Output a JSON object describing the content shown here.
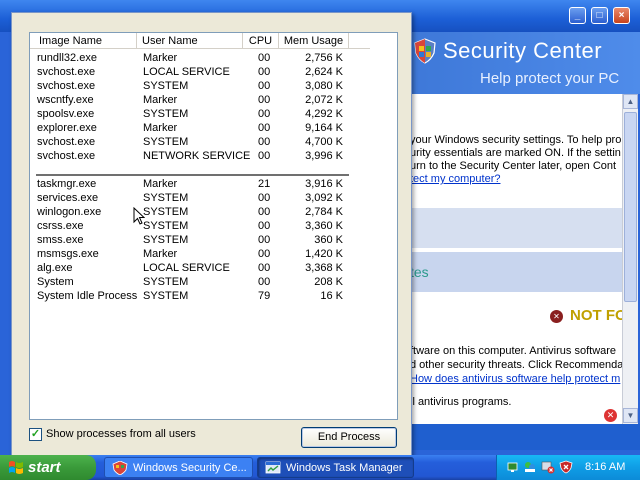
{
  "security_center": {
    "title": "Security Center",
    "subtitle": "Help protect your PC",
    "intro_lines": [
      "your Windows security settings. To help pro",
      "urity essentials are marked ON. If the settin",
      "urn to the Security Center later, open Cont"
    ],
    "intro_link": "tect my computer?",
    "updates_label": "tes",
    "not_found_label": "NOT FO",
    "av_lines": [
      "ftware on this computer. Antivirus software",
      "d other security threats. Click Recommenda"
    ],
    "av_link": "How does antivirus software help protect m",
    "av_line2": "ll antivirus programs."
  },
  "task_manager": {
    "columns": {
      "image": "Image Name",
      "user": "User Name",
      "cpu": "CPU",
      "mem": "Mem Usage"
    },
    "processes": [
      {
        "name": "rundll32.exe",
        "user": "Marker",
        "cpu": "00",
        "mem": "2,756 K"
      },
      {
        "name": "svchost.exe",
        "user": "LOCAL SERVICE",
        "cpu": "00",
        "mem": "2,624 K"
      },
      {
        "name": "svchost.exe",
        "user": "SYSTEM",
        "cpu": "00",
        "mem": "3,080 K"
      },
      {
        "name": "wscntfy.exe",
        "user": "Marker",
        "cpu": "00",
        "mem": "2,072 K"
      },
      {
        "name": "spoolsv.exe",
        "user": "SYSTEM",
        "cpu": "00",
        "mem": "4,292 K"
      },
      {
        "name": "explorer.exe",
        "user": "Marker",
        "cpu": "00",
        "mem": "9,164 K"
      },
      {
        "name": "svchost.exe",
        "user": "SYSTEM",
        "cpu": "00",
        "mem": "4,700 K"
      },
      {
        "name": "svchost.exe",
        "user": "NETWORK SERVICE",
        "cpu": "00",
        "mem": "3,996 K"
      },
      {
        "name": "",
        "user": "",
        "cpu": "",
        "mem": ""
      },
      {
        "name": "taskmgr.exe",
        "user": "Marker",
        "cpu": "21",
        "mem": "3,916 K"
      },
      {
        "name": "services.exe",
        "user": "SYSTEM",
        "cpu": "00",
        "mem": "3,092 K"
      },
      {
        "name": "winlogon.exe",
        "user": "SYSTEM",
        "cpu": "00",
        "mem": "2,784 K"
      },
      {
        "name": "csrss.exe",
        "user": "SYSTEM",
        "cpu": "00",
        "mem": "3,360 K"
      },
      {
        "name": "smss.exe",
        "user": "SYSTEM",
        "cpu": "00",
        "mem": "360 K"
      },
      {
        "name": "msmsgs.exe",
        "user": "Marker",
        "cpu": "00",
        "mem": "1,420 K"
      },
      {
        "name": "alg.exe",
        "user": "LOCAL SERVICE",
        "cpu": "00",
        "mem": "3,368 K"
      },
      {
        "name": "System",
        "user": "SYSTEM",
        "cpu": "00",
        "mem": "208 K"
      },
      {
        "name": "System Idle Process",
        "user": "SYSTEM",
        "cpu": "79",
        "mem": "16 K"
      }
    ],
    "show_all_label": "Show processes from all users",
    "show_all_checked": true,
    "end_process_label": "End Process"
  },
  "taskbar": {
    "start_label": "start",
    "tasks": [
      {
        "label": "Windows Security Ce...",
        "active": false
      },
      {
        "label": "Windows Task Manager",
        "active": true
      }
    ],
    "clock": "8:16 AM"
  },
  "icons": {
    "shield": "shield-icon",
    "not_found": "red-x-icon",
    "start_flag": "windows-flag-icon",
    "check": "check-icon",
    "cursor": "mouse-pointer-icon"
  },
  "colors": {
    "xp_blue": "#245edb",
    "start_green": "#3a9a3a",
    "tray_blue": "#0f9de5",
    "window_face": "#ece9d8",
    "warning_yellow": "#c0a000"
  }
}
